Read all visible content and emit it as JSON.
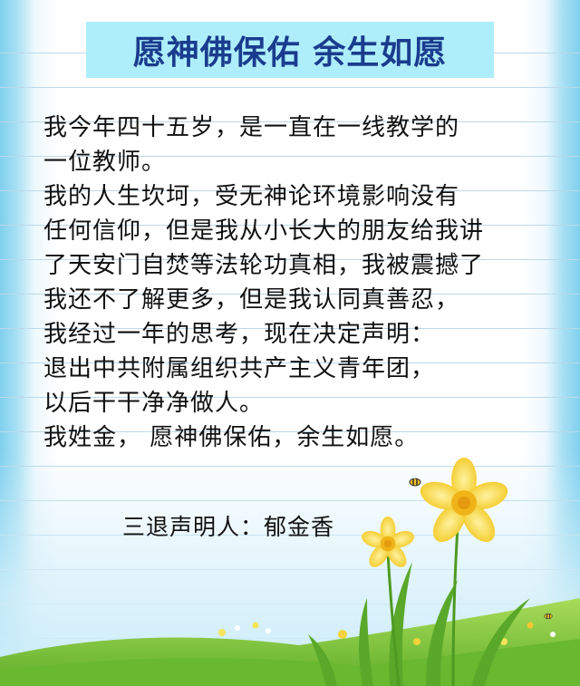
{
  "title": "愿神佛保佑 余生如愿",
  "body_lines": [
    "我今年四十五岁，是一直在一线教学的",
    "一位教师。",
    "我的人生坎坷，受无神论环境影响没有",
    "任何信仰，但是我从小长大的朋友给我讲",
    "了天安门自焚等法轮功真相，我被震撼了",
    "我还不了解更多，但是我认同真善忍，",
    "我经过一年的思考，现在决定声明：",
    "退出中共附属组织共产主义青年团，",
    "以后干干净净做人。",
    "我姓金， 愿神佛保佑，余生如愿。"
  ],
  "signature": "三退声明人：郁金香",
  "colors": {
    "title_bg": "#aeeefa",
    "title_text": "#1a3c8e",
    "rule_line": "#bcd9ea",
    "grass": "#7cc43a",
    "flower": "#f5d23a"
  },
  "icons": [
    "daffodil-icon",
    "bee-icon",
    "grass-hill-icon"
  ]
}
